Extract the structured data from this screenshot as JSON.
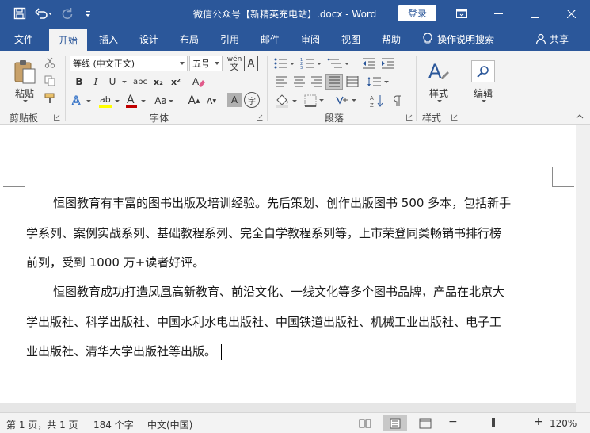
{
  "window": {
    "title": "微信公众号【新精英充电站】.docx  -  Word",
    "login_label": "登录",
    "qat": [
      "save-icon",
      "undo-icon",
      "redo-icon",
      "customize-icon"
    ]
  },
  "tabs": [
    {
      "label": "文件"
    },
    {
      "label": "开始"
    },
    {
      "label": "插入"
    },
    {
      "label": "设计"
    },
    {
      "label": "布局"
    },
    {
      "label": "引用"
    },
    {
      "label": "邮件"
    },
    {
      "label": "审阅"
    },
    {
      "label": "视图"
    },
    {
      "label": "帮助"
    }
  ],
  "active_tab": "开始",
  "tell_me": "操作说明搜索",
  "share": "共享",
  "ribbon": {
    "clipboard": {
      "paste_label": "粘贴",
      "group_label": "剪贴板"
    },
    "font": {
      "font_name": "等线 (中文正文)",
      "font_size": "五号",
      "group_label": "字体",
      "wen_label": "wén",
      "btn_bold": "B",
      "btn_italic": "I",
      "btn_underline": "U",
      "btn_strike": "abc",
      "btn_sub": "x₂",
      "btn_sup": "x²",
      "btn_aa": "Aa",
      "btn_grow": "A",
      "btn_shrink": "A",
      "btn_char_shade": "A",
      "btn_char_border": "字"
    },
    "paragraph": {
      "group_label": "段落"
    },
    "styles": {
      "styles_label": "样式",
      "group_label": "样式"
    },
    "editing": {
      "editing_label": "编辑"
    }
  },
  "document": {
    "para1": [
      "恒图教育有丰富的图书出版及培训经验。先后策划、创作出版图书 500 多本，包括新手",
      "学系列、案例实战系列、基础教程系列、完全自学教程系列等，上市荣登同类畅销书排行榜",
      "前列，受到 1000 万+读者好评。"
    ],
    "para2": [
      "恒图教育成功打造凤凰高新教育、前沿文化、一线文化等多个图书品牌，产品在北京大",
      "学出版社、科学出版社、中国水利水电出版社、中国铁道出版社、机械工业出版社、电子工",
      "业出版社、清华大学出版社等出版。"
    ]
  },
  "status": {
    "page": "第 1 页，共 1 页",
    "words": "184 个字",
    "lang": "中文(中国)",
    "zoom": "120%",
    "zoom_minus": "−",
    "zoom_plus": "+"
  },
  "colors": {
    "brand": "#2b579a",
    "highlight": "#ffff00",
    "font_color": "#c00000"
  }
}
